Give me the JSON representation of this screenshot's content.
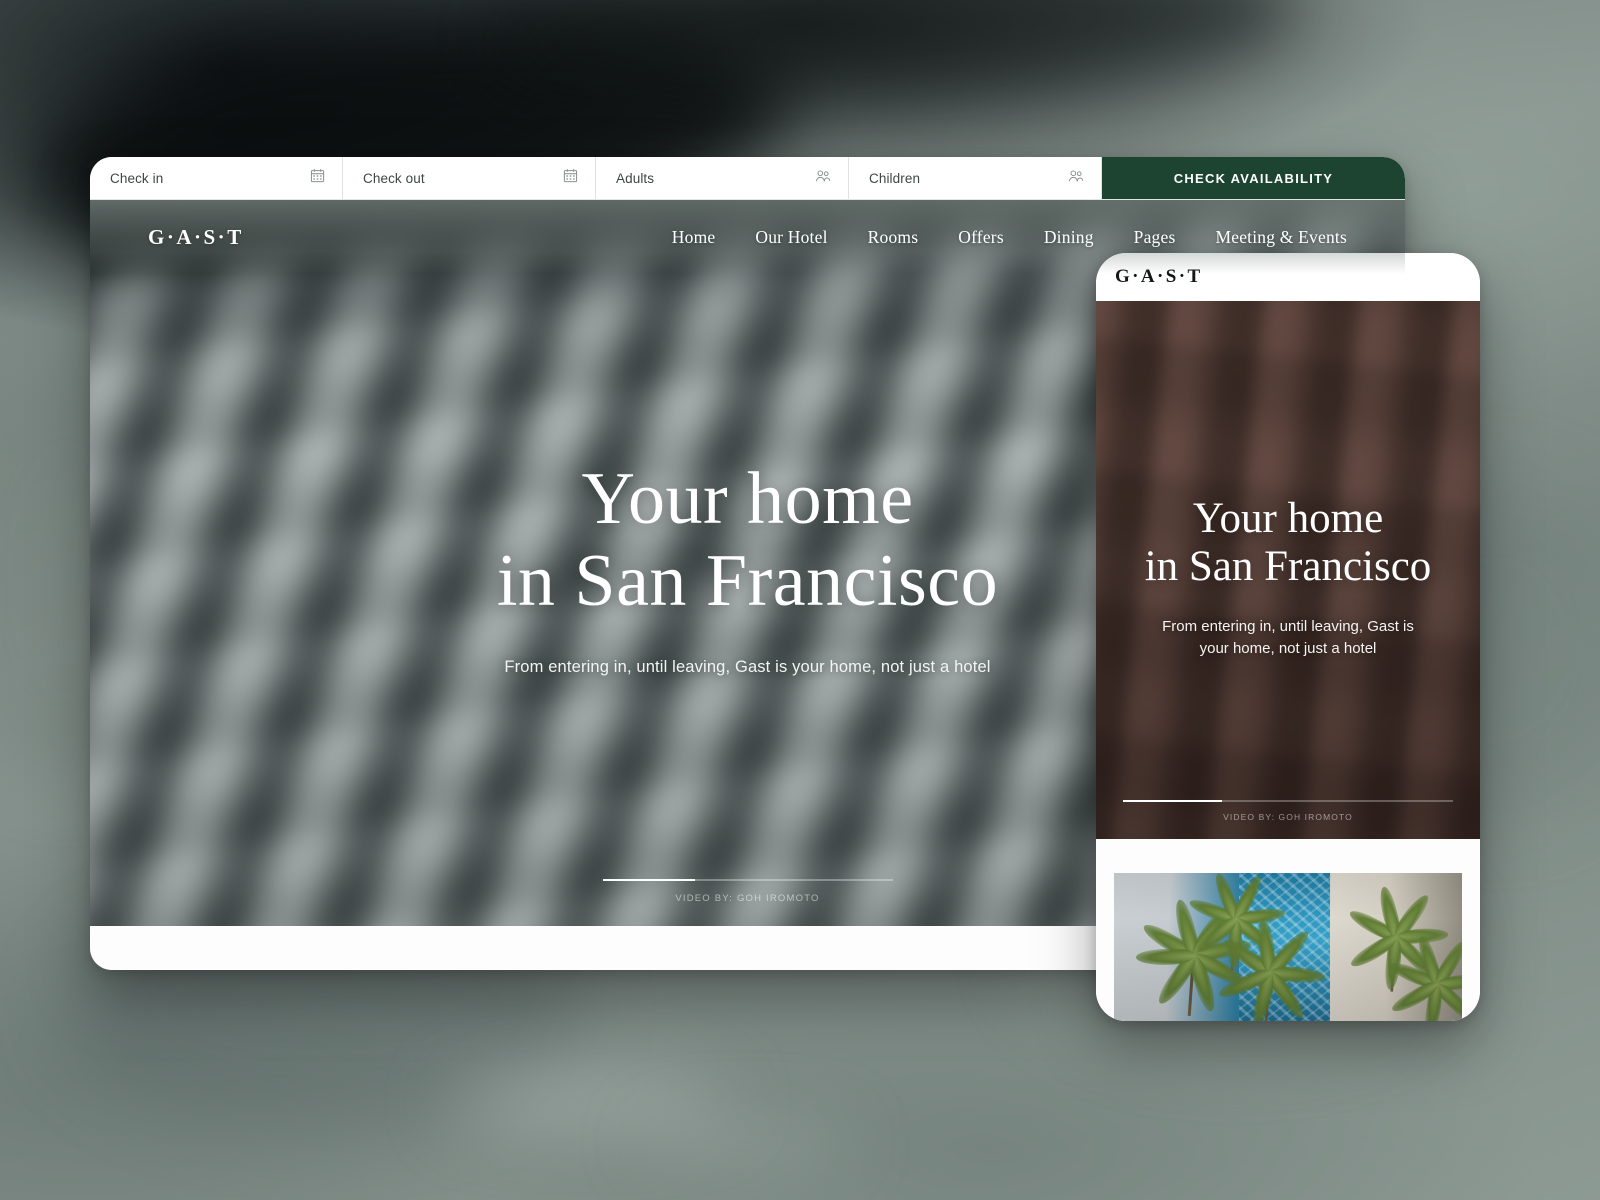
{
  "backdrop": {
    "note": "blurred photograph of a laptop keyboard, grey-green"
  },
  "desktop": {
    "booking_bar": {
      "fields": [
        {
          "label": "Check in",
          "icon": "calendar-icon"
        },
        {
          "label": "Check out",
          "icon": "calendar-icon"
        },
        {
          "label": "Adults",
          "icon": "guests-icon"
        },
        {
          "label": "Children",
          "icon": "guests-icon"
        }
      ],
      "cta_label": "CHECK AVAILABILITY",
      "cta_color": "#1d4430"
    },
    "nav": {
      "logo": "G·A·S·T",
      "items": [
        {
          "label": "Home"
        },
        {
          "label": "Our Hotel"
        },
        {
          "label": "Rooms"
        },
        {
          "label": "Offers"
        },
        {
          "label": "Dining"
        },
        {
          "label": "Pages"
        },
        {
          "label": "Meeting & Events"
        }
      ]
    },
    "hero": {
      "title_line1": "Your home",
      "title_line2": "in San Francisco",
      "subtitle": "From entering in, until leaving, Gast is your home, not just a hotel",
      "credit": "VIDEO BY: GOH IROMOTO"
    }
  },
  "mobile": {
    "logo": "G·A·S·T",
    "hero": {
      "title_line1": "Your home",
      "title_line2": "in San Francisco",
      "subtitle_line1": "From entering in, until leaving, Gast is",
      "subtitle_line2": "your home, not just a hotel",
      "credit": "VIDEO BY: GOH IROMOTO"
    },
    "gallery": {
      "alt": "aerial photo of swimming pool with palm trees"
    }
  }
}
